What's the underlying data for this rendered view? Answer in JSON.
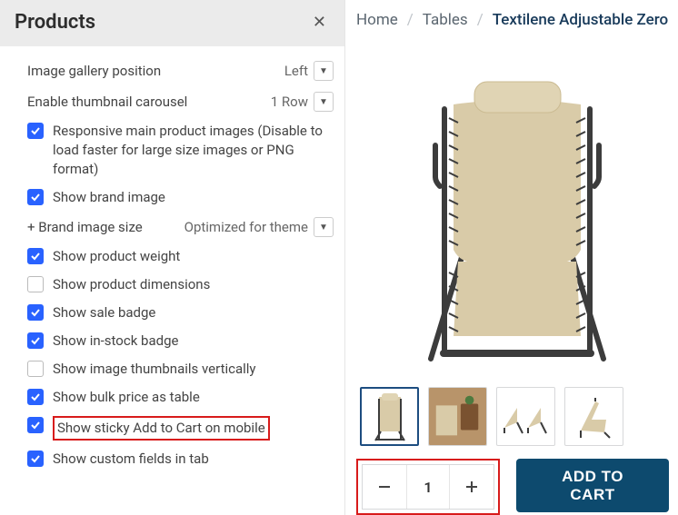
{
  "panel": {
    "title": "Products",
    "fields": {
      "gallery_position": {
        "label": "Image gallery position",
        "value": "Left"
      },
      "thumb_carousel": {
        "label": "Enable thumbnail carousel",
        "value": "1 Row"
      },
      "brand_image_size": {
        "label": "+ Brand image size",
        "value": "Optimized for theme"
      }
    },
    "checks": {
      "responsive": "Responsive main product images (Disable to load faster for large size images or PNG format)",
      "brand_image": "Show brand image",
      "weight": "Show product weight",
      "dimensions": "Show product dimensions",
      "sale_badge": "Show sale badge",
      "instock_badge": "Show in-stock badge",
      "thumb_vertical": "Show image thumbnails vertically",
      "bulk_price": "Show bulk price as table",
      "sticky_cart": "Show sticky Add to Cart on mobile",
      "custom_fields": "Show custom fields in tab"
    }
  },
  "breadcrumb": {
    "home": "Home",
    "tables": "Tables",
    "product": "Textilene Adjustable Zero"
  },
  "cart": {
    "qty": "1",
    "add_label": "ADD TO CART"
  }
}
